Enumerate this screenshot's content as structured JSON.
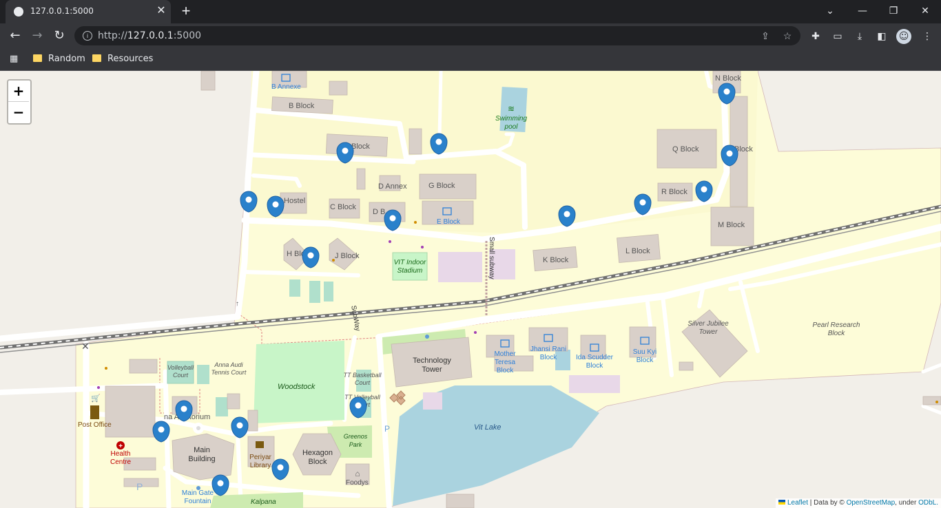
{
  "browser": {
    "tab_title": "127.0.0.1:5000",
    "tab_close": "✕",
    "new_tab": "+",
    "window": {
      "minimize": "⌄",
      "restore": "—",
      "maximize": "❐",
      "close": "✕"
    },
    "url_prefix": "http://",
    "url_host": "127.0.0.1",
    "url_suffix": ":5000",
    "bookmarks": [
      {
        "label": "Random"
      },
      {
        "label": "Resources"
      }
    ]
  },
  "map": {
    "zoom_in": "+",
    "zoom_out": "−",
    "attribution": {
      "leaflet": "Leaflet",
      "sep": " | Data by © ",
      "osm": "OpenStreetMap",
      "under": ", under ",
      "odbl": "ODbL."
    },
    "colors": {
      "campus": "#fdfcd8",
      "building": "#d9d0c9",
      "road": "#ffffff",
      "grass": "#cdebb0",
      "water": "#aad3df",
      "rail": "#707070",
      "marker": "#2a81cb",
      "label": "#555555",
      "edu_label": "#2d7fd8"
    },
    "labels": {
      "b_annexe": "B Annexe",
      "b_block": "B Block",
      "swimming_pool": "Swimming pool",
      "n_block": "N Block",
      "a_block": "Block",
      "q_block": "Q Block",
      "p_block": "Block",
      "d_annex": "D Annex",
      "g_block": "G Block",
      "r_block": "R Block",
      "hostel": "Hostel",
      "c_block": "C Block",
      "d_block": "D B",
      "e_block": "E Block",
      "m_block": "M Block",
      "h_block": "H Blo",
      "j_block": "J Block",
      "indoor_stadium": "VIT Indoor Stadium",
      "small_subway": "Small subway",
      "k_block": "K Block",
      "l_block": "L Block",
      "subway": "SubWay",
      "silver_jubilee": "Silver Jubilee Tower",
      "pearl_research": "Pearl Research Block",
      "mother_teresa": "Mother Teresa Block",
      "jhansi_rani": "Jhansi Rani Block",
      "ida_scudder": "Ida Scudder Block",
      "suu_kyi": "Suu Kyi Block",
      "technology_tower": "Technology Tower",
      "volleyball": "Volleyball Court",
      "anna_audi": "Anna Audi Tennis Court",
      "woodstock": "Woodstock",
      "tt_basketball": "TT Basketball Court",
      "tt_volleyball": "TT Volleyball Court",
      "vit_lake": "Vit Lake",
      "post_office": "Post Office",
      "anna_auditorium": "na Auditorium",
      "greenos_park": "Greenos Park",
      "health_centre": "Health Centre",
      "main_building": "Main Building",
      "periyar_library": "Periyar Library",
      "hexagon_block": "Hexagon Block",
      "foodys": "Foodys",
      "main_gate_fountain": "Main Gate Fountain",
      "kalpana": "Kalpana",
      "p_parking": "P"
    },
    "marker_count": 18
  }
}
